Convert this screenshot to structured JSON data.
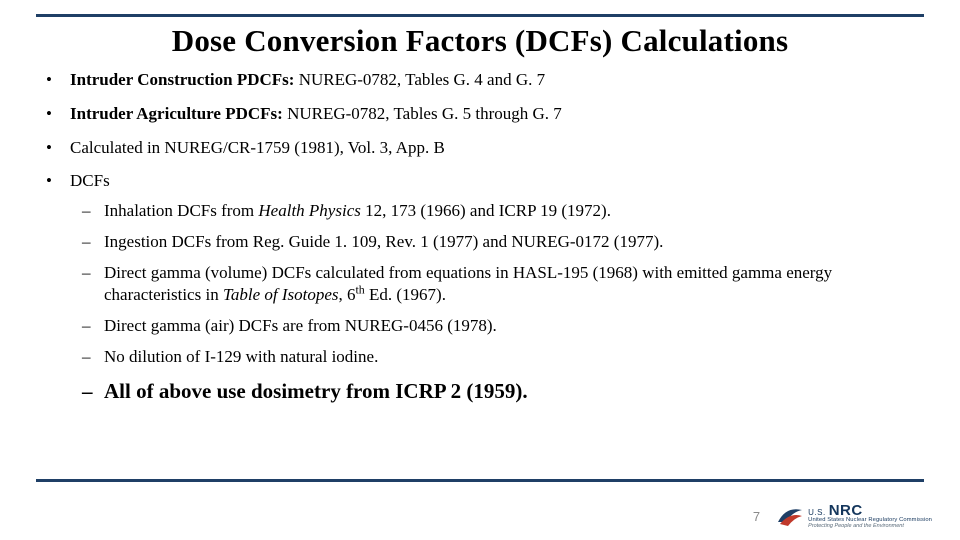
{
  "title": "Dose Conversion Factors (DCFs) Calculations",
  "bullets": {
    "b1_bold": "Intruder Construction PDCFs:",
    "b1_rest": "  NUREG-0782, Tables G. 4 and G. 7",
    "b2_bold": "Intruder Agriculture PDCFs:",
    "b2_rest": "  NUREG-0782, Tables G. 5 through G. 7",
    "b3": "Calculated in NUREG/CR-1759 (1981), Vol. 3, App. B",
    "b4": "DCFs",
    "sub": {
      "s1a": "Inhalation DCFs from ",
      "s1_ital": "Health Physics",
      "s1b": " 12, 173 (1966) and ICRP 19 (1972).",
      "s2": "Ingestion DCFs from Reg. Guide 1. 109, Rev. 1 (1977) and NUREG-0172 (1977).",
      "s3a": "Direct gamma (volume) DCFs calculated from equations in HASL-195 (1968) with emitted gamma energy characteristics in ",
      "s3_ital": "Table of Isotopes",
      "s3b": ", 6",
      "s3_sup": "th",
      "s3c": " Ed. (1967).",
      "s4": "Direct gamma (air) DCFs are from NUREG-0456 (1978).",
      "s5": "No dilution of I-129 with natural iodine.",
      "s6": "All of above use dosimetry from ICRP 2 (1959)."
    }
  },
  "page_number": "7",
  "logo": {
    "us": "U.S.",
    "nrc": "NRC",
    "line1": "United States Nuclear Regulatory Commission",
    "line2": "Protecting People and the Environment"
  }
}
